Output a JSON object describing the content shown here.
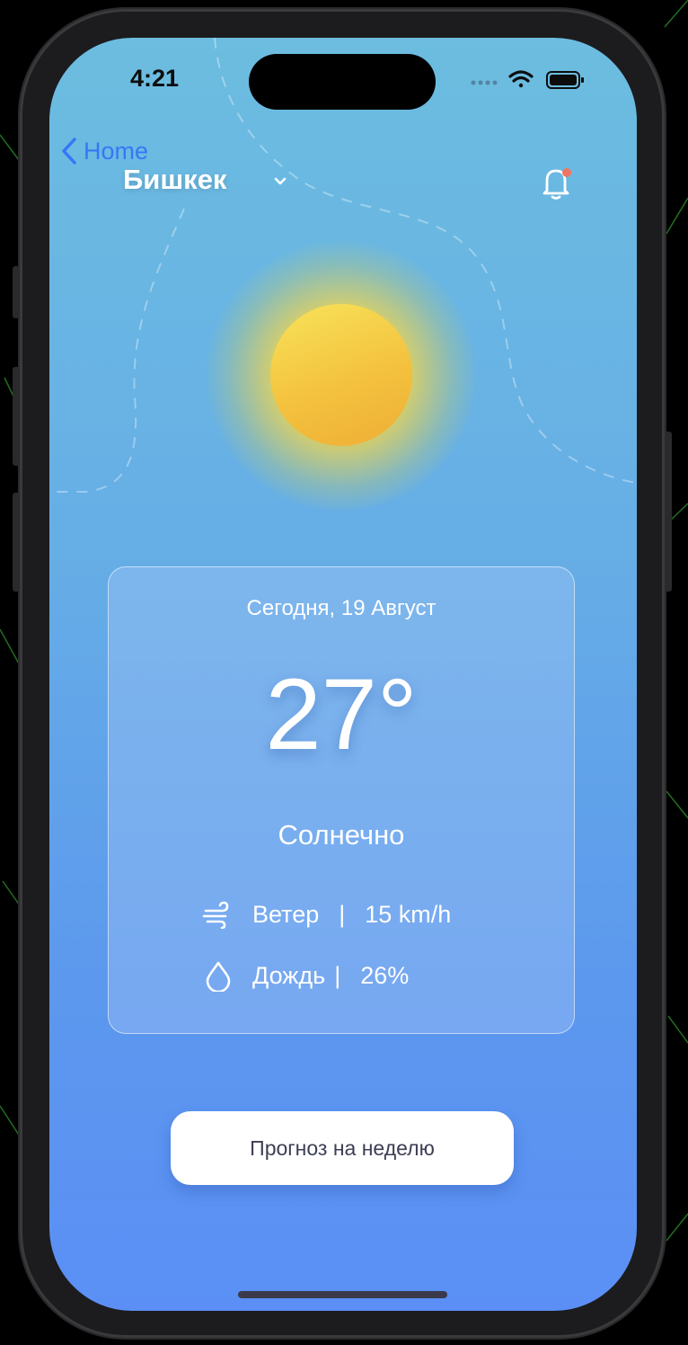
{
  "status_bar": {
    "time": "4:21"
  },
  "nav": {
    "back_label": "Home"
  },
  "header": {
    "city": "Бишкек"
  },
  "weather": {
    "date": "Сегодня, 19 Август",
    "temperature": "27°",
    "condition": "Солнечно",
    "wind_label": "Ветер",
    "wind_value": "15 km/h",
    "rain_label": "Дождь",
    "rain_value": "26%",
    "separator": "|"
  },
  "actions": {
    "week_forecast_label": "Прогноз на неделю"
  },
  "colors": {
    "sky_top": "#6cbde0",
    "sky_bottom": "#5b8ff5",
    "sun": "#f4c23e",
    "back_link": "#3478f6",
    "notification_dot": "#ef7560"
  },
  "icons": [
    "chevron-left-icon",
    "chevron-down-icon",
    "bell-icon",
    "wind-icon",
    "raindrop-icon",
    "wifi-icon",
    "battery-icon"
  ]
}
